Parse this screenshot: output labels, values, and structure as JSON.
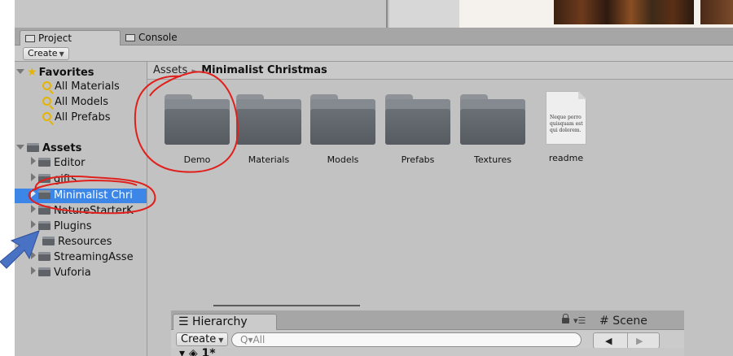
{
  "tabs": {
    "project": "Project",
    "console": "Console"
  },
  "toolbar": {
    "create_label": "Create"
  },
  "favorites": {
    "title": "Favorites",
    "items": [
      "All Materials",
      "All Models",
      "All Prefabs"
    ]
  },
  "assets_tree": {
    "title": "Assets",
    "items": [
      "Editor",
      "gifts",
      "Minimalist Chri",
      "NatureStarterK",
      "Plugins",
      "Resources",
      "StreamingAsse",
      "Vuforia"
    ],
    "selected": "Minimalist Chri"
  },
  "breadcrumb": {
    "root": "Assets",
    "current": "Minimalist Christmas"
  },
  "assets_grid": [
    {
      "label": "Demo",
      "icon": "folder-icon"
    },
    {
      "label": "Materials",
      "icon": "folder-icon"
    },
    {
      "label": "Models",
      "icon": "folder-icon"
    },
    {
      "label": "Prefabs",
      "icon": "folder-icon"
    },
    {
      "label": "Textures",
      "icon": "folder-icon"
    },
    {
      "label": "readme",
      "icon": "document-icon",
      "preview_text": "Neque porro quisquam est qui dolorem."
    }
  ],
  "hierarchy": {
    "tab_label": "Hierarchy",
    "create_label": "Create",
    "search_placeholder": "All",
    "row_label": "1*"
  },
  "scene": {
    "tab_label": "Scene"
  },
  "colors": {
    "selection": "#3b86e6",
    "annotation_red": "#e0201c",
    "annotation_arrow": "#4a72c4",
    "panel_bg": "#c2c2c2"
  }
}
